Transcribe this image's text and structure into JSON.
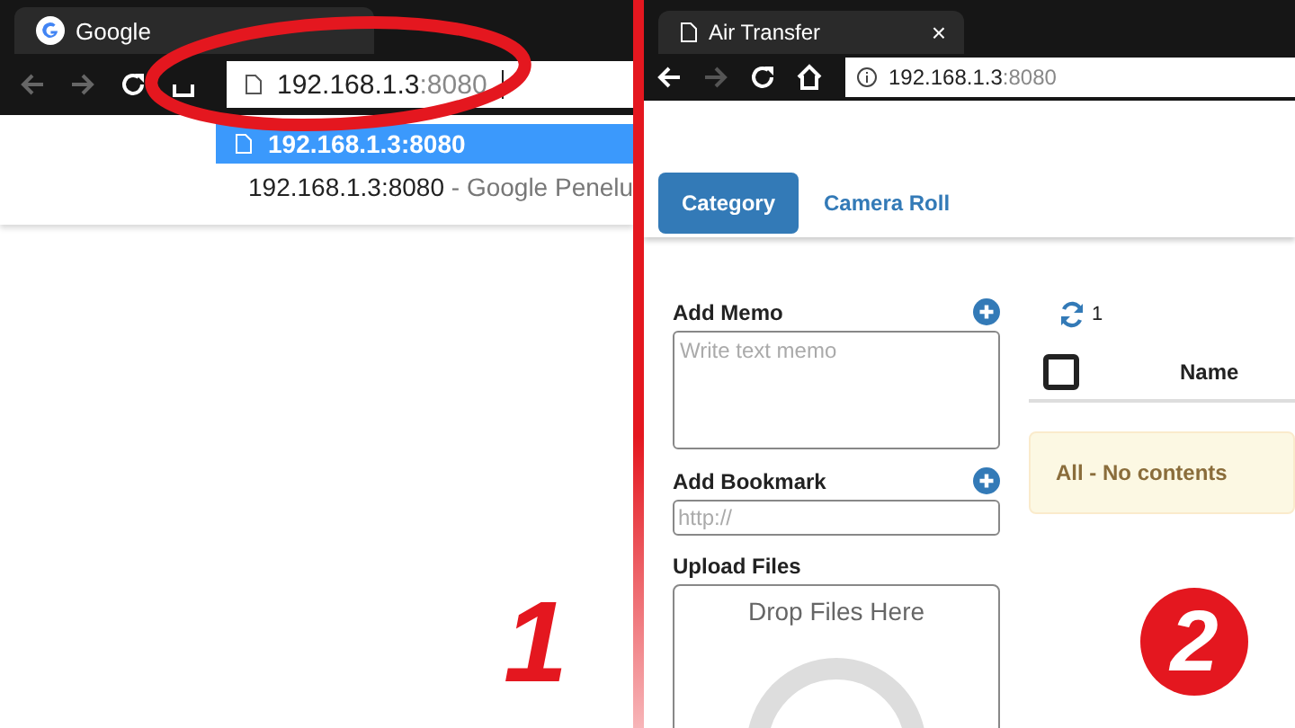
{
  "left": {
    "tab_title": "Google",
    "address": {
      "host": "192.168.1.3",
      "port": ":8080"
    },
    "suggestions": [
      {
        "text": "192.168.1.3:8080",
        "kind": "page",
        "selected": true
      },
      {
        "text": "192.168.1.3:8080",
        "suffix": " - Google Penelu",
        "kind": "search",
        "selected": false
      }
    ],
    "step": "1"
  },
  "right": {
    "tab_title": "Air Transfer",
    "tab_close": "×",
    "address": {
      "host": "192.168.1.3",
      "port": ":8080"
    },
    "nav_tabs": [
      {
        "label": "Category",
        "selected": true
      },
      {
        "label": "Camera Roll",
        "selected": false
      }
    ],
    "memo": {
      "label": "Add Memo",
      "placeholder": "Write text memo"
    },
    "bookmark": {
      "label": "Add Bookmark",
      "placeholder": "http://"
    },
    "upload": {
      "label": "Upload Files",
      "drop_text": "Drop Files Here"
    },
    "refresh_count": "1",
    "select_all": {
      "checked": false
    },
    "columns": [
      "Name"
    ],
    "alert": "All - No contents",
    "step": "2"
  }
}
